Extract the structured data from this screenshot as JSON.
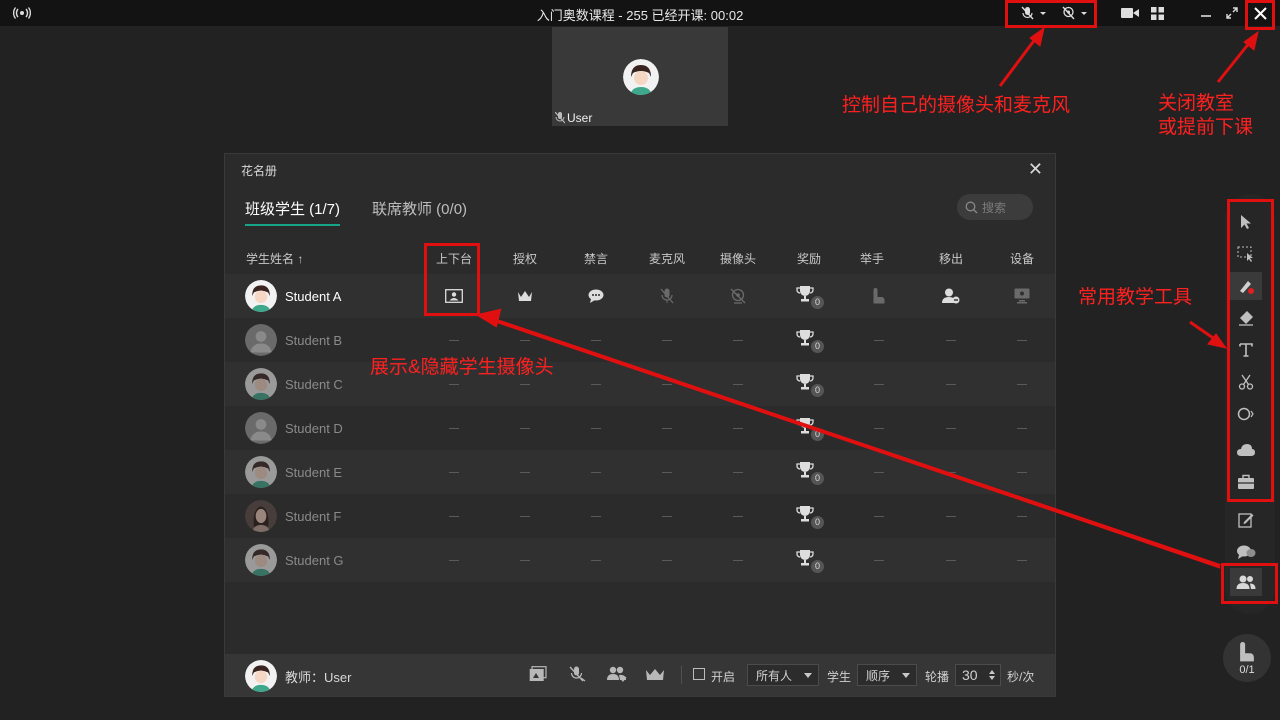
{
  "window": {
    "title": "入门奥数课程 - 255   已经开课: 00:02",
    "broadcast_icon": "broadcast-icon",
    "controls": [
      "mic-muted-icon",
      "camera-off-icon",
      "video-icon",
      "grid-icon",
      "minimize-icon",
      "maximize-icon",
      "close-icon"
    ]
  },
  "video_tile": {
    "username": "User"
  },
  "annotations": {
    "camera_mic": "控制自己的摄像头和麦克风",
    "close_line1": "关闭教室",
    "close_line2": "或提前下课",
    "tools": "常用教学工具",
    "stage": "展示&隐藏学生摄像头"
  },
  "roster": {
    "title": "花名册",
    "tabs": [
      {
        "label": "班级学生 (1/7)",
        "active": true
      },
      {
        "label": "联席教师 (0/0)",
        "active": false
      }
    ],
    "search_placeholder": "搜索",
    "columns": [
      "学生姓名 ↑",
      "上下台",
      "授权",
      "禁言",
      "麦克风",
      "摄像头",
      "奖励",
      "举手",
      "移出",
      "设备"
    ],
    "students": [
      {
        "name": "Student A",
        "online": true,
        "trophies": "0"
      },
      {
        "name": "Student B",
        "online": false,
        "trophies": "0"
      },
      {
        "name": "Student C",
        "online": false,
        "trophies": "0"
      },
      {
        "name": "Student D",
        "online": false,
        "trophies": "0"
      },
      {
        "name": "Student E",
        "online": false,
        "trophies": "0"
      },
      {
        "name": "Student F",
        "online": false,
        "trophies": "0"
      },
      {
        "name": "Student G",
        "online": false,
        "trophies": "0"
      }
    ],
    "footer": {
      "teacher": "教师：User",
      "open_label": "开启",
      "audience": "所有人",
      "student_label": "学生",
      "order": "顺序",
      "rotate_label": "轮播",
      "interval": "30",
      "unit": "秒/次"
    }
  },
  "toolbar": {
    "tools": [
      "select-arrow-icon",
      "area-select-icon",
      "pen-icon",
      "eraser-icon",
      "text-icon",
      "scissors-icon",
      "shape-icon",
      "cloud-icon",
      "toolbox-icon",
      "edit-note-icon",
      "chat-icon",
      "roster-icon"
    ],
    "hands_count": "0/1"
  },
  "colors": {
    "accent": "#17a58a",
    "annotation": "#e01010",
    "background": "#222222"
  }
}
